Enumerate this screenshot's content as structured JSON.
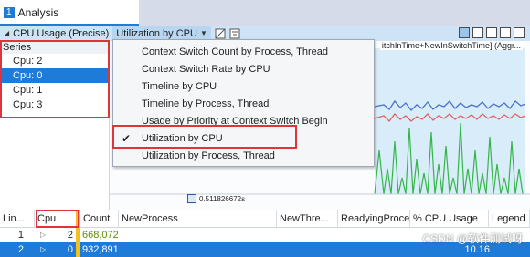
{
  "tabs": {
    "number": "1",
    "label": "Analysis"
  },
  "graph": {
    "title": "CPU Usage (Precise)",
    "preset": "Utilization by CPU",
    "column_header": "itchInTime+NewInSwitchTime] (Aggr...",
    "axis_value": "0.511826672s"
  },
  "series": {
    "header": "Series",
    "items": [
      {
        "label": "Cpu: 2",
        "selected": false
      },
      {
        "label": "Cpu: 0",
        "selected": true
      },
      {
        "label": "Cpu: 1",
        "selected": false
      },
      {
        "label": "Cpu: 3",
        "selected": false
      }
    ]
  },
  "menu": {
    "items": [
      {
        "label": "Context Switch Count by Process, Thread",
        "checked": false
      },
      {
        "label": "Context Switch Rate by CPU",
        "checked": false
      },
      {
        "label": "Timeline by CPU",
        "checked": false
      },
      {
        "label": "Timeline by Process, Thread",
        "checked": false
      },
      {
        "label": "Usage by Priority at Context Switch Begin",
        "checked": false
      },
      {
        "label": "Utilization by CPU",
        "checked": true
      },
      {
        "label": "Utilization by Process, Thread",
        "checked": false
      }
    ],
    "check_glyph": "✔"
  },
  "table": {
    "columns": [
      "Lin...",
      "Cpu",
      "Count",
      "NewProcess",
      "NewThre...",
      "ReadyingProce",
      "% CPU Usage",
      "Legend"
    ],
    "rows": [
      {
        "line": "1",
        "cpu": "2",
        "count": "668,072",
        "pct": "",
        "selected": false
      },
      {
        "line": "2",
        "cpu": "0",
        "count": "932,891",
        "pct": "10.16",
        "selected": true
      }
    ]
  },
  "watermark": "CSDN @软件测试呀",
  "colors": {
    "accent": "#1e7bd7",
    "highlight_box": "#e0333b",
    "cpu_column_marker": "#f2c21a",
    "series_blue": "#4a72c8",
    "series_red": "#e06464",
    "series_green": "#35b548"
  }
}
